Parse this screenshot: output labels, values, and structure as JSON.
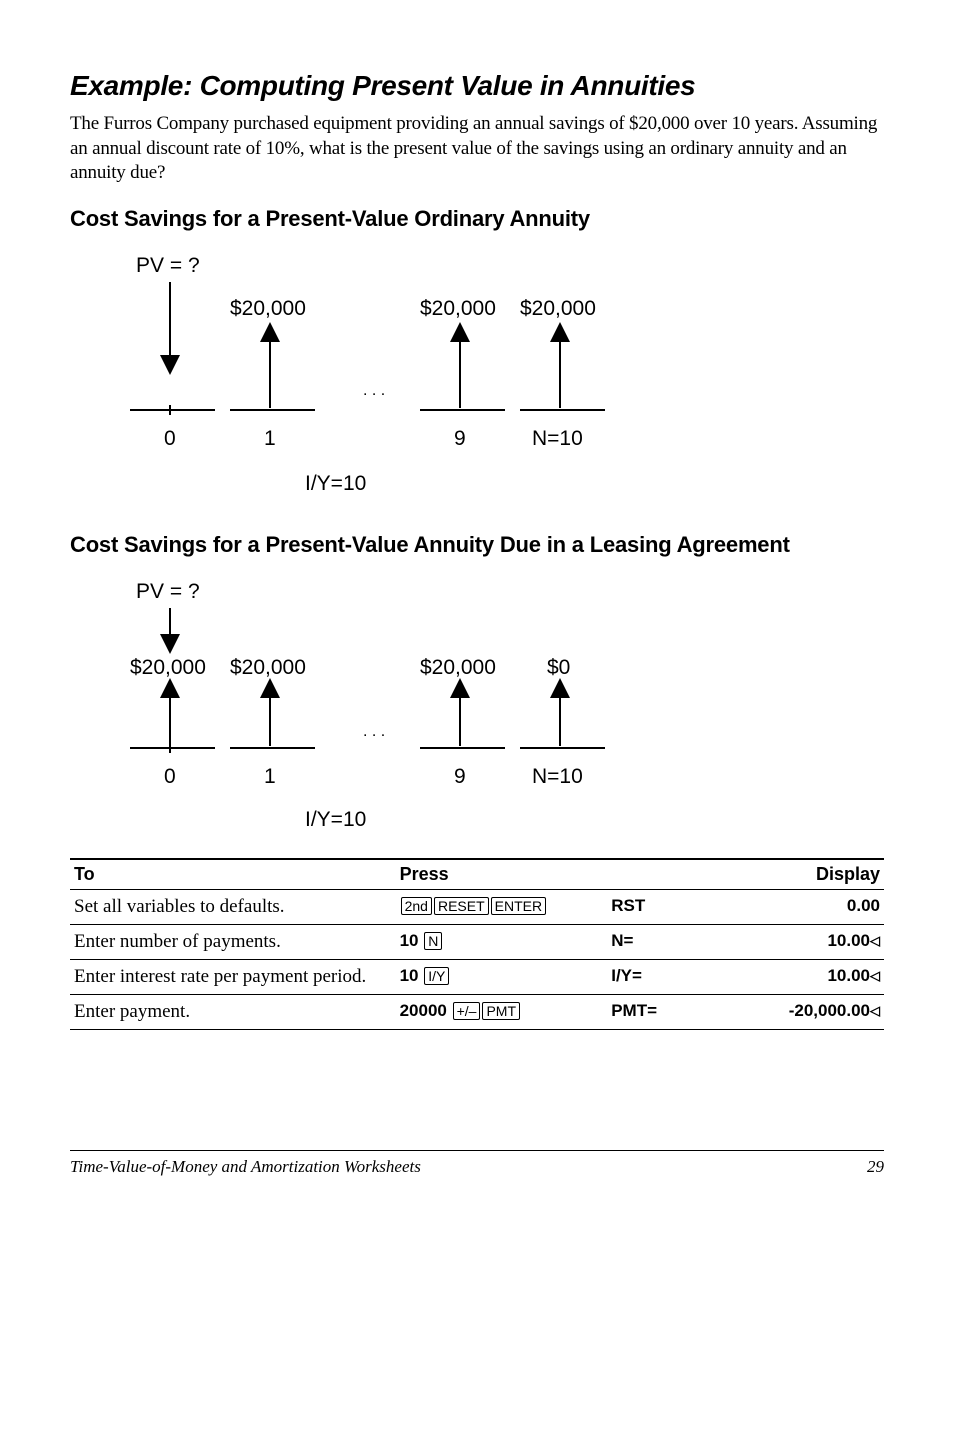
{
  "title": "Example: Computing Present Value in Annuities",
  "intro": "The Furros Company purchased equipment providing an annual savings of $20,000 over 10 years. Assuming an annual discount rate of 10%, what is the present value of the savings using an ordinary annuity and an annuity due?",
  "sub1": "Cost Savings for a Present-Value Ordinary Annuity",
  "sub2": "Cost Savings for a Present-Value Annuity Due in a Leasing Agreement",
  "diagram1": {
    "pv": "PV = ?",
    "amt": "$20,000",
    "ticks": [
      "0",
      "1",
      "9"
    ],
    "n": "N=10",
    "iy": "I/Y=10"
  },
  "diagram2": {
    "pv": "PV = ?",
    "amts": [
      "$20,000",
      "$20,000",
      "$20,000",
      "$0"
    ],
    "ticks": [
      "0",
      "1",
      "9"
    ],
    "n": "N=10",
    "iy": "I/Y=10"
  },
  "table": {
    "headers": [
      "To",
      "Press",
      "Display"
    ],
    "rows": [
      {
        "to": "Set all variables to defaults.",
        "press_num": "",
        "keys": [
          "2nd",
          "RESET",
          "ENTER"
        ],
        "label": "RST",
        "value": "0.00"
      },
      {
        "to": "Enter number of payments.",
        "press_num": "10",
        "keys": [
          "N"
        ],
        "label": "N=",
        "value": "10.00◁"
      },
      {
        "to": "Enter interest rate per payment period.",
        "press_num": "10",
        "keys": [
          "I/Y"
        ],
        "label": "I/Y=",
        "value": "10.00◁"
      },
      {
        "to": "Enter payment.",
        "press_num": "20000",
        "keys": [
          "+/–",
          "PMT"
        ],
        "label": "PMT=",
        "value": "-20,000.00◁"
      }
    ]
  },
  "footer": {
    "title": "Time-Value-of-Money and Amortization Worksheets",
    "page": "29"
  },
  "chart_data": [
    {
      "type": "timeline-cashflow",
      "title": "Cost Savings for a Present-Value Ordinary Annuity",
      "unknown": "PV",
      "periods": {
        "start": 0,
        "end": 10
      },
      "cash_flows": [
        {
          "t": 0,
          "value": null,
          "direction": "down",
          "label": "PV = ?"
        },
        {
          "t": 1,
          "value": 20000,
          "direction": "up",
          "label": "$20,000"
        },
        {
          "t": 9,
          "value": 20000,
          "direction": "up",
          "label": "$20,000"
        },
        {
          "t": 10,
          "value": 20000,
          "direction": "up",
          "label": "$20,000"
        }
      ],
      "rate_label": "I/Y=10"
    },
    {
      "type": "timeline-cashflow",
      "title": "Cost Savings for a Present-Value Annuity Due in a Leasing Agreement",
      "unknown": "PV",
      "periods": {
        "start": 0,
        "end": 10
      },
      "cash_flows": [
        {
          "t": 0,
          "pv_direction": "down",
          "value": 20000,
          "direction": "up",
          "label": "$20,000"
        },
        {
          "t": 1,
          "value": 20000,
          "direction": "up",
          "label": "$20,000"
        },
        {
          "t": 9,
          "value": 20000,
          "direction": "up",
          "label": "$20,000"
        },
        {
          "t": 10,
          "value": 0,
          "direction": "up",
          "label": "$0"
        }
      ],
      "rate_label": "I/Y=10"
    }
  ]
}
